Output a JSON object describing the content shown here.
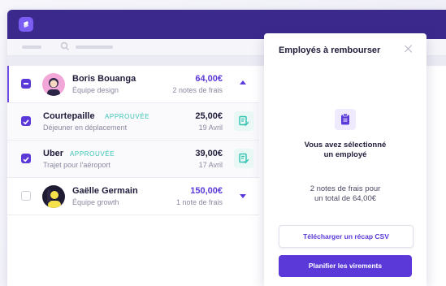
{
  "colors": {
    "brand": "#3b2a8c",
    "accent": "#5b39d9",
    "success": "#38c4b2"
  },
  "rows": [
    {
      "name": "Boris Bouanga",
      "meta": "Équipe design",
      "amount": "64,00€",
      "amount_sub": "2 notes de frais",
      "checkbox": "partial",
      "icon": "chevron-up-icon"
    },
    {
      "name": "Courtepaille",
      "badge": "APPROUVÉE",
      "meta": "Déjeuner en déplacement",
      "amount": "25,00€",
      "amount_sub": "19 Avril",
      "checkbox": "checked",
      "icon": "receipt-check-icon"
    },
    {
      "name": "Uber",
      "badge": "APPROUVÉE",
      "meta": "Trajet pour l'aéroport",
      "amount": "39,00€",
      "amount_sub": "17 Avril",
      "checkbox": "checked",
      "icon": "receipt-check-icon"
    },
    {
      "name": "Gaëlle Germain",
      "meta": "Équipe growth",
      "amount": "150,00€",
      "amount_sub": "1 note de frais",
      "checkbox": "unchecked",
      "icon": "chevron-down-icon"
    }
  ],
  "panel": {
    "title": "Employés à rembourser",
    "selected_line1": "Vous avez sélectionné",
    "selected_line2": "un employé",
    "total_line1": "2 notes de frais pour",
    "total_line2": "un total de 64,00€",
    "csv_button": "Télécharger un récap CSV",
    "plan_button": "Planifier les virements"
  }
}
